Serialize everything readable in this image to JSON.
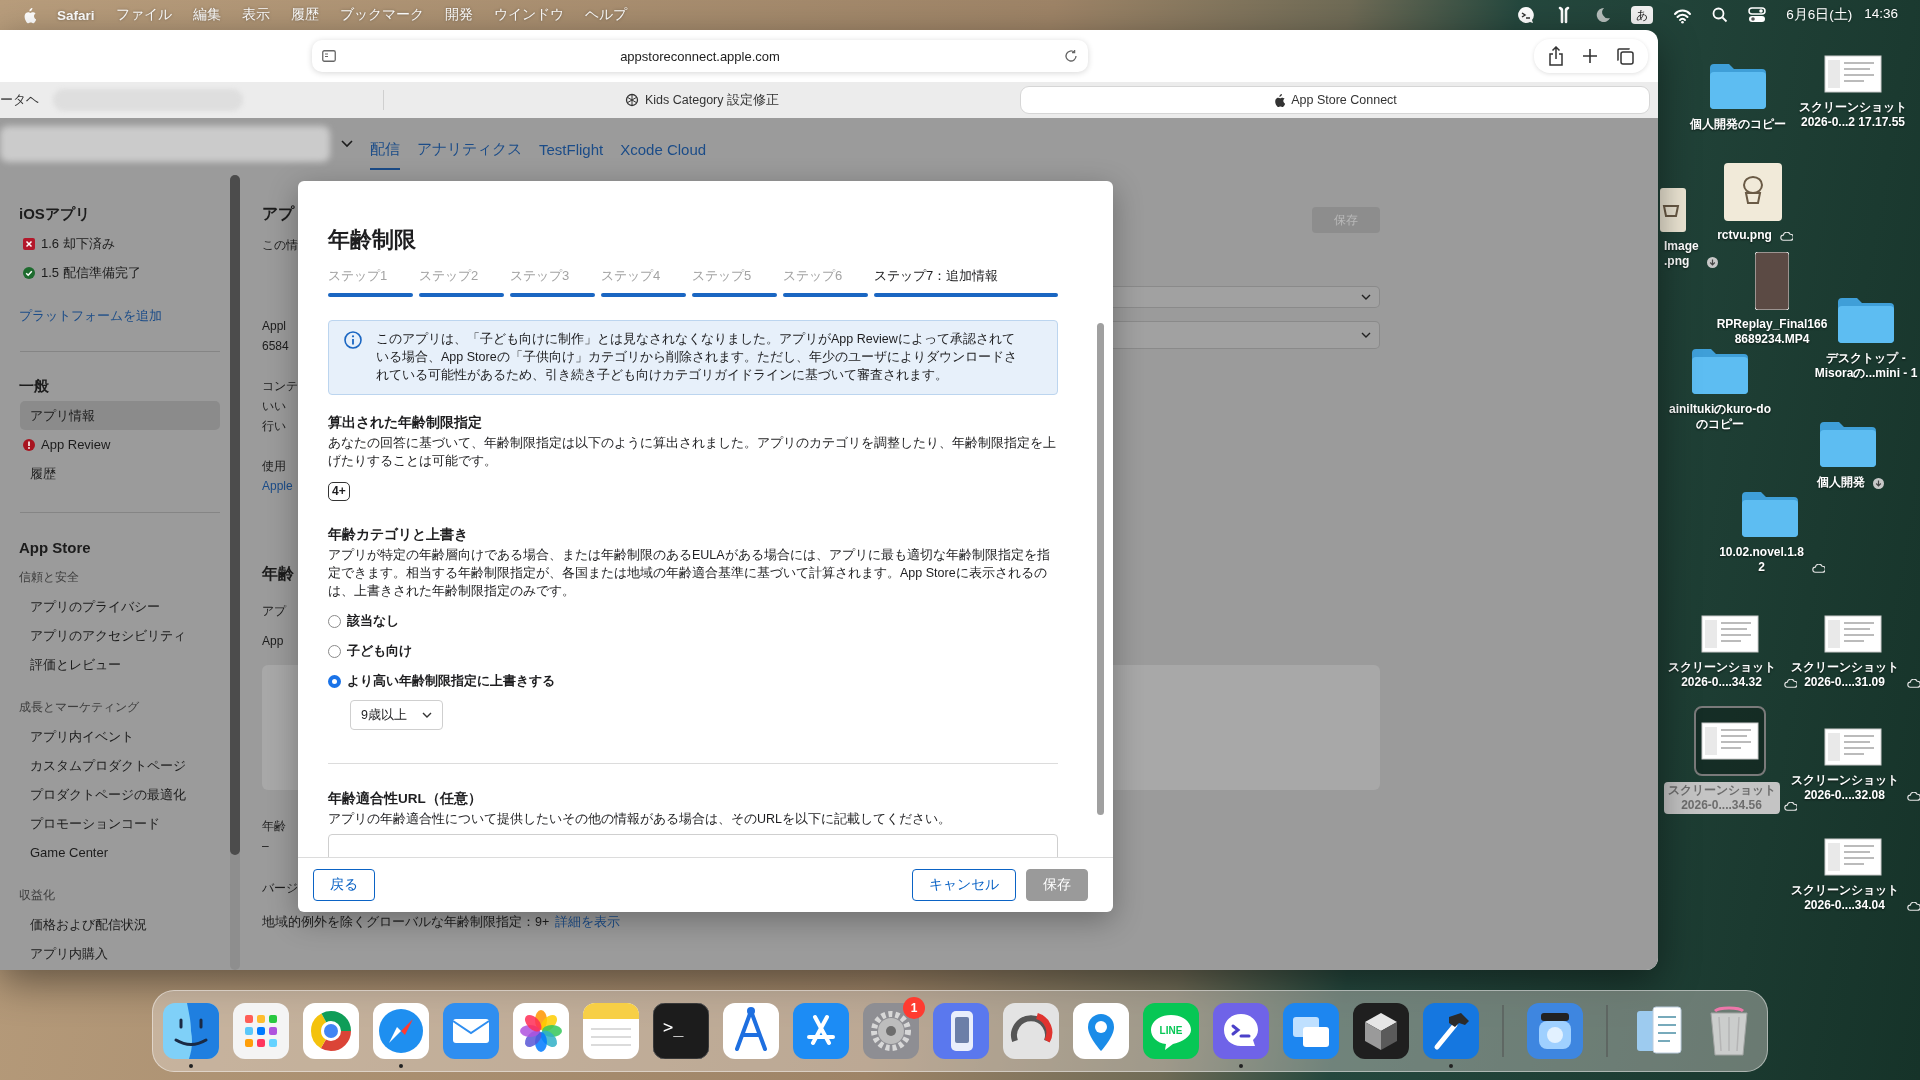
{
  "menu_bar": {
    "app": "Safari",
    "menus": [
      "ファイル",
      "編集",
      "表示",
      "履歴",
      "ブックマーク",
      "開発",
      "ウインドウ",
      "ヘルプ"
    ],
    "input_mode": "あ",
    "date": "6月6日(土)",
    "time": "14:36"
  },
  "browser": {
    "address": "appstoreconnect.apple.com",
    "tabs": [
      {
        "title": "ータヘ",
        "selected": false
      },
      {
        "title": "Kids Category 設定修正",
        "selected": false
      },
      {
        "title": "App Store Connect",
        "selected": true
      }
    ],
    "nav": [
      {
        "label": "配信",
        "selected": true
      },
      {
        "label": "アナリティクス",
        "selected": false
      },
      {
        "label": "TestFlight",
        "selected": false
      },
      {
        "label": "Xcode Cloud",
        "selected": false
      }
    ]
  },
  "sidebar": {
    "sections": [
      {
        "heading": "iOSアプリ",
        "groups": [
          {
            "items": [
              {
                "label": "1.6 却下済み",
                "kind": "rejected",
                "selected": false
              },
              {
                "label": "1.5 配信準備完了",
                "kind": "ready",
                "selected": false
              }
            ]
          }
        ],
        "link": "プラットフォームを追加"
      },
      {
        "heading": "一般",
        "groups": [
          {
            "items": [
              {
                "label": "アプリ情報",
                "selected": true
              },
              {
                "label": "App Review",
                "kind": "attention",
                "selected": false
              },
              {
                "label": "履歴",
                "selected": false
              }
            ]
          }
        ]
      },
      {
        "heading": "App Store",
        "groups": [
          {
            "subheading": "信頼と安全",
            "items": [
              {
                "label": "アプリのプライバシー",
                "selected": false
              },
              {
                "label": "アプリのアクセシビリティ",
                "selected": false
              },
              {
                "label": "評価とレビュー",
                "selected": false
              }
            ]
          },
          {
            "subheading": "成長とマーケティング",
            "items": [
              {
                "label": "アプリ内イベント",
                "selected": false
              },
              {
                "label": "カスタムプロダクトページ",
                "selected": false
              },
              {
                "label": "プロダクトページの最適化",
                "selected": false
              },
              {
                "label": "プロモーションコード",
                "selected": false
              },
              {
                "label": "Game Center",
                "selected": false
              }
            ]
          },
          {
            "subheading": "収益化",
            "items": [
              {
                "label": "価格および配信状況",
                "selected": false
              },
              {
                "label": "アプリ内購入",
                "selected": false
              }
            ]
          }
        ]
      }
    ]
  },
  "page_behind": {
    "fragments": [
      {
        "kind": "title",
        "text": "アプ"
      },
      {
        "kind": "text",
        "text": "この情"
      },
      {
        "kind": "text",
        "text": "Appl"
      },
      {
        "kind": "text",
        "text": "6584"
      },
      {
        "kind": "text",
        "text": "コンテ"
      },
      {
        "kind": "text",
        "text": "いい"
      },
      {
        "kind": "text",
        "text": "行い"
      },
      {
        "kind": "text",
        "text": "使用"
      },
      {
        "kind": "link",
        "text": "Apple"
      },
      {
        "kind": "title",
        "text": "年齢"
      },
      {
        "kind": "text",
        "text": "アプ"
      },
      {
        "kind": "text",
        "text": "App"
      },
      {
        "kind": "panel"
      },
      {
        "kind": "text",
        "text": "年齢"
      },
      {
        "kind": "text",
        "text": "–"
      },
      {
        "kind": "text",
        "text": "バージ"
      }
    ],
    "save_button": {
      "label": "保存",
      "disabled": true
    },
    "footer_text": "地域的例外を除くグローバルな年齢制限指定：9+",
    "footer_link": "詳細を表示"
  },
  "modal": {
    "title": "年齢制限",
    "steps": [
      {
        "label": "ステップ1",
        "selected": false
      },
      {
        "label": "ステップ2",
        "selected": false
      },
      {
        "label": "ステップ3",
        "selected": false
      },
      {
        "label": "ステップ4",
        "selected": false
      },
      {
        "label": "ステップ5",
        "selected": false
      },
      {
        "label": "ステップ6",
        "selected": false
      },
      {
        "label": "ステップ7：追加情報",
        "selected": true
      }
    ],
    "notice": "このアプリは、「子ども向けに制作」とは見なされなくなりました。アプリがApp Reviewによって承認されている場合、App Storeの「子供向け」カテゴリから削除されます。ただし、年少のユーザによりダウンロードされている可能性があるため、引き続き子ども向けカテゴリガイドラインに基づいて審査されます。",
    "sections": [
      {
        "kind": "rating",
        "heading": "算出された年齢制限指定",
        "description": "あなたの回答に基づいて、年齢制限指定は以下のように算出されました。アプリのカテゴリを調整したり、年齢制限指定を上げたりすることは可能です。",
        "rating": "4+"
      },
      {
        "kind": "options",
        "heading": "年齢カテゴリと上書き",
        "description": "アプリが特定の年齢層向けである場合、または年齢制限のあるEULAがある場合には、アプリに最も適切な年齢制限指定を指定できます。相当する年齢制限指定が、各国または地域の年齢適合基準に基づいて計算されます。App Storeに表示されるのは、上書きされた年齢制限指定のみです。",
        "options": [
          {
            "label": "該当なし",
            "selected": false
          },
          {
            "label": "子ども向け",
            "selected": false
          },
          {
            "label": "より高い年齢制限指定に上書きする",
            "selected": true
          }
        ],
        "select": "9歳以上"
      },
      {
        "kind": "url",
        "heading": "年齢適合性URL（任意）",
        "description": "アプリの年齢適合性について提供したいその他の情報がある場合は、そのURLを以下に記載してください。"
      }
    ],
    "buttons": [
      {
        "kind": "back",
        "label": "戻る",
        "disabled": false
      },
      {
        "kind": "cancel",
        "label": "キャンセル",
        "disabled": false
      },
      {
        "kind": "save",
        "label": "保存",
        "disabled": true
      }
    ]
  },
  "desktop": {
    "items": [
      {
        "kind": "folder",
        "lines": [
          "個人開発のコピー"
        ],
        "in_cloud": false,
        "downloadable": false,
        "selected": false
      },
      {
        "kind": "screenshot",
        "lines": [
          "スクリーンショット",
          "2026-0...2 17.17.55"
        ],
        "in_cloud": false,
        "downloadable": false,
        "selected": false
      },
      {
        "kind": "partial-image",
        "lines": [
          "Image",
          ".png"
        ],
        "in_cloud": false,
        "downloadable": true,
        "selected": false
      },
      {
        "kind": "image",
        "lines": [
          "rctvu.png"
        ],
        "in_cloud": true,
        "downloadable": false,
        "selected": false
      },
      {
        "kind": "video",
        "lines": [
          "RPReplay_Final166",
          "8689234.MP4"
        ],
        "in_cloud": false,
        "downloadable": false,
        "selected": false
      },
      {
        "kind": "folder",
        "lines": [
          "デスクトップ -",
          "Misoraの...mini - 1"
        ],
        "in_cloud": false,
        "downloadable": false,
        "selected": false
      },
      {
        "kind": "folder",
        "lines": [
          "ainiltukiのkuro-do",
          "のコピー"
        ],
        "in_cloud": false,
        "downloadable": false,
        "selected": false
      },
      {
        "kind": "folder",
        "lines": [
          "個人開発"
        ],
        "in_cloud": false,
        "downloadable": true,
        "selected": false
      },
      {
        "kind": "folder",
        "lines": [
          "10.02.novel.1.8",
          "2"
        ],
        "in_cloud": true,
        "downloadable": false,
        "selected": false
      },
      {
        "kind": "screenshot",
        "lines": [
          "スクリーンショット",
          "2026-0....34.32"
        ],
        "in_cloud": true,
        "downloadable": false,
        "selected": false
      },
      {
        "kind": "screenshot",
        "lines": [
          "スクリーンショット",
          "2026-0....31.09"
        ],
        "in_cloud": true,
        "downloadable": false,
        "selected": false
      },
      {
        "kind": "screenshot",
        "lines": [
          "スクリーンショット",
          "2026-0....34.56"
        ],
        "in_cloud": true,
        "downloadable": false,
        "selected": true
      },
      {
        "kind": "screenshot",
        "lines": [
          "スクリーンショット",
          "2026-0....32.08"
        ],
        "in_cloud": true,
        "downloadable": false,
        "selected": false
      },
      {
        "kind": "screenshot",
        "lines": [
          "スクリーンショット",
          "2026-0....34.04"
        ],
        "in_cloud": true,
        "downloadable": false,
        "selected": false
      }
    ]
  },
  "dock": {
    "groups": [
      [
        {
          "kind": "finder",
          "running": true
        },
        {
          "kind": "launchpad",
          "running": false
        },
        {
          "kind": "chrome",
          "running": false
        },
        {
          "kind": "safari",
          "running": true
        },
        {
          "kind": "mail",
          "running": false
        },
        {
          "kind": "photos",
          "running": false
        },
        {
          "kind": "notes",
          "running": false
        },
        {
          "kind": "terminal",
          "text": ">_",
          "running": false
        },
        {
          "kind": "instruments",
          "running": false
        },
        {
          "kind": "appstore",
          "running": false
        },
        {
          "kind": "settings",
          "badge": "1",
          "running": false
        },
        {
          "kind": "simulator",
          "running": false
        },
        {
          "kind": "gauge",
          "running": false
        },
        {
          "kind": "pin",
          "running": false
        },
        {
          "kind": "line",
          "text": "LINE",
          "running": false
        },
        {
          "kind": "copilot",
          "running": true
        },
        {
          "kind": "windows",
          "running": false
        },
        {
          "kind": "cube",
          "running": false
        },
        {
          "kind": "xcode",
          "running": true
        }
      ],
      [
        {
          "kind": "lens",
          "running": false
        }
      ],
      [
        {
          "kind": "documents",
          "running": false
        },
        {
          "kind": "trash",
          "running": false
        }
      ]
    ]
  }
}
